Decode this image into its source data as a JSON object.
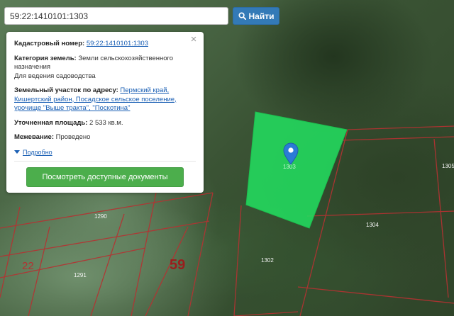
{
  "search": {
    "value": "59:22:1410101:1303",
    "button_label": "Найти"
  },
  "info_panel": {
    "cadastral_label": "Кадастровый номер:",
    "cadastral_value": "59:22:1410101:1303",
    "category_label": "Категория земель:",
    "category_value_line1": "Земли сельскохозяйственного",
    "category_value_line2": "назначения",
    "category_use": "Для ведения садоводства",
    "address_label": "Земельный участок по адресу:",
    "address_line1": "Пермский край,",
    "address_line2": "Кишертский район, Посадское сельское поселение,",
    "address_line3": "урочище \"Выше тракта\", \"Поскотина\"",
    "area_label": "Уточненная площадь:",
    "area_value": "2 533 кв.м.",
    "survey_label": "Межевание:",
    "survey_value": "Проведено",
    "more_label": "Подробно",
    "docs_button_label": "Посмотреть доступные документы"
  },
  "map": {
    "highlight_color": "#22e060",
    "boundary_color": "#b53232",
    "labels": {
      "parcel_selected": "1303",
      "p1290": "1290",
      "p1291": "1291",
      "p1302": "1302",
      "p1304": "1304",
      "p1305": "1305",
      "block22": "22",
      "block59": "59"
    }
  }
}
